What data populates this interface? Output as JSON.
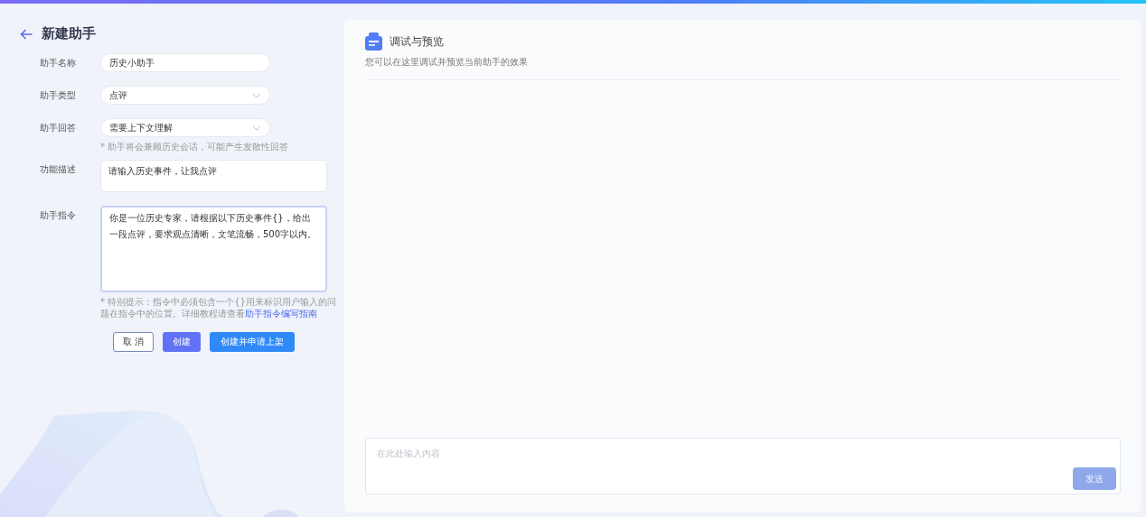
{
  "page": {
    "title": "新建助手"
  },
  "form": {
    "fields": [
      {
        "kind": "text",
        "label": "助手名称",
        "value": "历史小助手"
      },
      {
        "kind": "select",
        "label": "助手类型",
        "value": "点评"
      },
      {
        "kind": "select",
        "label": "助手回答",
        "value": "需要上下文理解",
        "hint": "* 助手将会兼顾历史会话，可能产生发散性回答"
      },
      {
        "kind": "textarea",
        "label": "功能描述",
        "value": "请输入历史事件，让我点评"
      },
      {
        "kind": "prompt",
        "label": "助手指令",
        "value": "你是一位历史专家，请根据以下历史事件{}，给出一段点评，要求观点清晰，文笔流畅，500字以内。",
        "focused": true,
        "hint": "* 特别提示：指令中必须包含一个{}用来标识用户输入的问题在指令中的位置。详细教程请查看",
        "hint_link": "助手指令编写指南"
      }
    ],
    "buttons": [
      {
        "kind": "outline",
        "label": "取 消"
      },
      {
        "kind": "primary",
        "label": "创建"
      },
      {
        "kind": "blue",
        "label": "创建并申请上架"
      }
    ]
  },
  "preview": {
    "title": "调试与预览",
    "subtitle": "您可以在这里调试并预览当前助手的效果",
    "input": {
      "placeholder": "在此处输入内容"
    },
    "send_button": {
      "label": "发送",
      "disabled": true
    }
  }
}
